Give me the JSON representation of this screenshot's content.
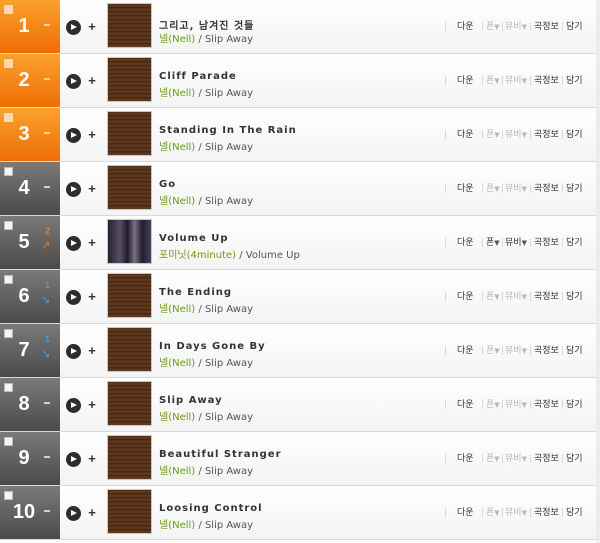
{
  "actions": {
    "download": "다운",
    "ringtone": "폰",
    "video": "뮤비",
    "songinfo": "곡정보",
    "add": "담기"
  },
  "buttons": {
    "add_symbol": "+"
  },
  "separator": " / ",
  "rows": [
    {
      "rank": "1",
      "move": "same",
      "move_num": "",
      "top": true,
      "title": "그리고, 남겨진 것들",
      "artist": "넬(Nell)",
      "album": "Slip Away",
      "art": "brown",
      "actions_active": false
    },
    {
      "rank": "2",
      "move": "same",
      "move_num": "",
      "top": true,
      "title": "Cliff Parade",
      "artist": "넬(Nell)",
      "album": "Slip Away",
      "art": "brown",
      "actions_active": false
    },
    {
      "rank": "3",
      "move": "same",
      "move_num": "",
      "top": true,
      "title": "Standing In The Rain",
      "artist": "넬(Nell)",
      "album": "Slip Away",
      "art": "brown",
      "actions_active": false
    },
    {
      "rank": "4",
      "move": "same",
      "move_num": "",
      "top": false,
      "title": "Go",
      "artist": "넬(Nell)",
      "album": "Slip Away",
      "art": "brown",
      "actions_active": false
    },
    {
      "rank": "5",
      "move": "up",
      "move_num": "2",
      "top": false,
      "title": "Volume Up",
      "artist": "포미닛(4minute)",
      "album": "Volume Up",
      "art": "photo",
      "actions_active": true
    },
    {
      "rank": "6",
      "move": "down",
      "move_num": "1",
      "top": false,
      "title": "The Ending",
      "artist": "넬(Nell)",
      "album": "Slip Away",
      "art": "brown",
      "actions_active": false
    },
    {
      "rank": "7",
      "move": "down",
      "move_num": "1",
      "top": false,
      "title": "In Days Gone By",
      "artist": "넬(Nell)",
      "album": "Slip Away",
      "art": "brown",
      "actions_active": false
    },
    {
      "rank": "8",
      "move": "same",
      "move_num": "",
      "top": false,
      "title": "Slip Away",
      "artist": "넬(Nell)",
      "album": "Slip Away",
      "art": "brown",
      "actions_active": false
    },
    {
      "rank": "9",
      "move": "same",
      "move_num": "",
      "top": false,
      "title": "Beautiful Stranger",
      "artist": "넬(Nell)",
      "album": "Slip Away",
      "art": "brown",
      "actions_active": false
    },
    {
      "rank": "10",
      "move": "same",
      "move_num": "",
      "top": false,
      "title": "Loosing Control",
      "artist": "넬(Nell)",
      "album": "Slip Away",
      "art": "brown",
      "actions_active": false
    }
  ],
  "icons": {
    "play": "play-icon",
    "add": "plus-icon",
    "same": "dash-icon",
    "up": "arrow-up-icon",
    "down": "arrow-down-icon"
  },
  "colors": {
    "top_rank": "#f58a14",
    "other_rank": "#5a5a5a",
    "artist": "#6d9a12",
    "rank_up": "#ff7a10",
    "rank_down": "#3da0e8"
  }
}
